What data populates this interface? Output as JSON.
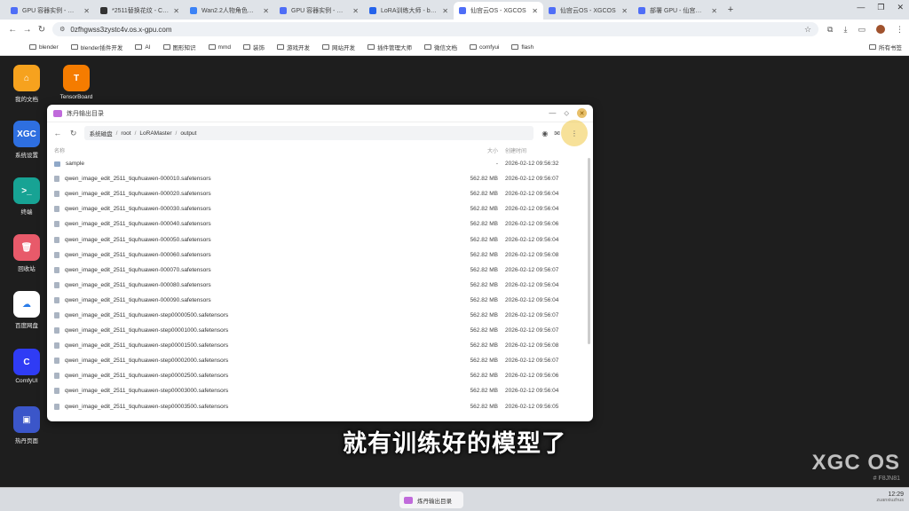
{
  "browser": {
    "tabs": [
      {
        "title": "GPU 容器实例 - 仙宫云 X",
        "favicon_color": "#4f6ef7"
      },
      {
        "title": "*2511替换花纹 - ComfyUI",
        "favicon_color": "#333333"
      },
      {
        "title": "Wan2.2人物角色高画质工作流",
        "favicon_color": "#3b82f6"
      },
      {
        "title": "GPU 容器实例 - 仙宫云 X",
        "favicon_color": "#4f6ef7"
      },
      {
        "title": "LoRA训练大师 - by AI刷",
        "favicon_color": "#2563eb"
      },
      {
        "title": "仙宫云OS - XGCOS",
        "favicon_color": "#4f6ef7",
        "active": true
      },
      {
        "title": "仙宫云OS - XGCOS",
        "favicon_color": "#4f6ef7"
      },
      {
        "title": "部署 GPU - 仙宫云 Xian",
        "favicon_color": "#4f6ef7"
      }
    ],
    "url": "0zfhgwss3zystc4v.os.x-gpu.com",
    "bookmarks": [
      "blender",
      "blender插件开发",
      "AI",
      "图形知识",
      "mmd",
      "装饰",
      "游戏开发",
      "网站开发",
      "插件管理大师",
      "微信文档",
      "comfyui",
      "flash"
    ],
    "all_bookmarks": "所有书签"
  },
  "desktop": {
    "icons": [
      {
        "label": "我的文档",
        "tile_text": "⌂",
        "color": "#f6a21e"
      },
      {
        "label": "TensorBoard",
        "tile_text": "T",
        "color": "#f57c00"
      },
      {
        "label": "系统设置",
        "tile_text": "XGC",
        "color": "#2e6fe0"
      },
      {
        "label": "终端",
        "tile_text": ">_",
        "color": "#17a394"
      },
      {
        "label": "回收站",
        "tile_text": "🗑",
        "color": "#e85a6a"
      },
      {
        "label": "百度网盘",
        "tile_text": "☁",
        "color": "#ffffff"
      },
      {
        "label": "ComfyUI",
        "tile_text": "C",
        "color": "#2f3cf5"
      },
      {
        "label": "热丹页面",
        "tile_text": "▣",
        "color": "#3b56c9"
      }
    ]
  },
  "file_manager": {
    "title": "炼丹输出目录",
    "path": [
      "系统磁盘",
      "root",
      "LoRAMaster",
      "output"
    ],
    "columns": {
      "name": "名称",
      "size": "大小",
      "time": "创建时间"
    },
    "rows": [
      {
        "name": "sample",
        "size": "-",
        "time": "2026-02-12 09:56:32",
        "type": "folder"
      },
      {
        "name": "qwen_image_edit_2511_tiquhuawen-000010.safetensors",
        "size": "562.82 MB",
        "time": "2026-02-12 09:56:07",
        "type": "file"
      },
      {
        "name": "qwen_image_edit_2511_tiquhuawen-000020.safetensors",
        "size": "562.82 MB",
        "time": "2026-02-12 09:56:04",
        "type": "file"
      },
      {
        "name": "qwen_image_edit_2511_tiquhuawen-000030.safetensors",
        "size": "562.82 MB",
        "time": "2026-02-12 09:56:04",
        "type": "file"
      },
      {
        "name": "qwen_image_edit_2511_tiquhuawen-000040.safetensors",
        "size": "562.82 MB",
        "time": "2026-02-12 09:56:06",
        "type": "file"
      },
      {
        "name": "qwen_image_edit_2511_tiquhuawen-000050.safetensors",
        "size": "562.82 MB",
        "time": "2026-02-12 09:56:04",
        "type": "file"
      },
      {
        "name": "qwen_image_edit_2511_tiquhuawen-000060.safetensors",
        "size": "562.82 MB",
        "time": "2026-02-12 09:56:08",
        "type": "file"
      },
      {
        "name": "qwen_image_edit_2511_tiquhuawen-000070.safetensors",
        "size": "562.82 MB",
        "time": "2026-02-12 09:56:07",
        "type": "file"
      },
      {
        "name": "qwen_image_edit_2511_tiquhuawen-000080.safetensors",
        "size": "562.82 MB",
        "time": "2026-02-12 09:56:04",
        "type": "file"
      },
      {
        "name": "qwen_image_edit_2511_tiquhuawen-000090.safetensors",
        "size": "562.82 MB",
        "time": "2026-02-12 09:56:04",
        "type": "file"
      },
      {
        "name": "qwen_image_edit_2511_tiquhuawen-step00000500.safetensors",
        "size": "562.82 MB",
        "time": "2026-02-12 09:56:07",
        "type": "file"
      },
      {
        "name": "qwen_image_edit_2511_tiquhuawen-step00001000.safetensors",
        "size": "562.82 MB",
        "time": "2026-02-12 09:56:07",
        "type": "file"
      },
      {
        "name": "qwen_image_edit_2511_tiquhuawen-step00001500.safetensors",
        "size": "562.82 MB",
        "time": "2026-02-12 09:56:08",
        "type": "file"
      },
      {
        "name": "qwen_image_edit_2511_tiquhuawen-step00002000.safetensors",
        "size": "562.82 MB",
        "time": "2026-02-12 09:56:07",
        "type": "file"
      },
      {
        "name": "qwen_image_edit_2511_tiquhuawen-step00002500.safetensors",
        "size": "562.82 MB",
        "time": "2026-02-12 09:56:06",
        "type": "file"
      },
      {
        "name": "qwen_image_edit_2511_tiquhuawen-step00003000.safetensors",
        "size": "562.82 MB",
        "time": "2026-02-12 09:56:04",
        "type": "file"
      },
      {
        "name": "qwen_image_edit_2511_tiquhuawen-step00003500.safetensors",
        "size": "562.82 MB",
        "time": "2026-02-12 09:56:05",
        "type": "file"
      }
    ]
  },
  "subtitle": "就有训练好的模型了",
  "watermark": {
    "brand": "XGC OS",
    "code": "# F8JN81"
  },
  "taskbar": {
    "item": "炼丹输出目录",
    "time": "12:29",
    "sub": "zuanxiuzhus"
  }
}
